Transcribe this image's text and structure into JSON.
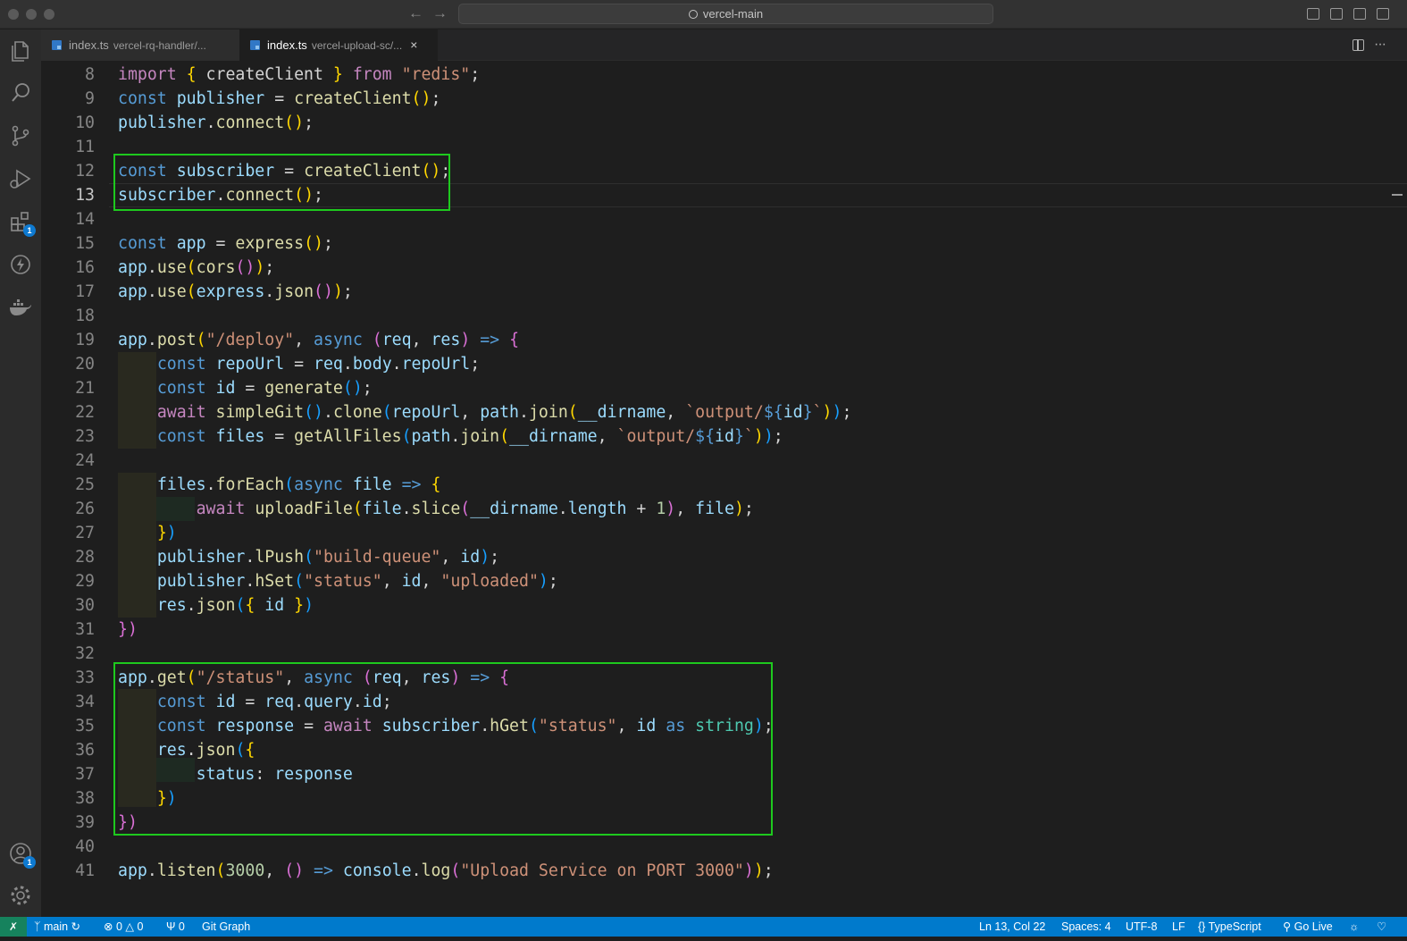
{
  "window": {
    "search_label": "vercel-main"
  },
  "tabs": [
    {
      "name": "index.ts",
      "path": "vercel-rq-handler/...",
      "active": false
    },
    {
      "name": "index.ts",
      "path": "vercel-upload-sc/...",
      "active": true,
      "close": "×"
    }
  ],
  "activity": {
    "extensions_badge": "1",
    "accounts_badge": "1"
  },
  "editor": {
    "current_line": 13,
    "lines": [
      {
        "n": "8"
      },
      {
        "n": "9"
      },
      {
        "n": "10"
      },
      {
        "n": "11"
      },
      {
        "n": "12"
      },
      {
        "n": "13"
      },
      {
        "n": "14"
      },
      {
        "n": "15"
      },
      {
        "n": "16"
      },
      {
        "n": "17"
      },
      {
        "n": "18"
      },
      {
        "n": "19"
      },
      {
        "n": "20"
      },
      {
        "n": "21"
      },
      {
        "n": "22"
      },
      {
        "n": "23"
      },
      {
        "n": "24"
      },
      {
        "n": "25"
      },
      {
        "n": "26"
      },
      {
        "n": "27"
      },
      {
        "n": "28"
      },
      {
        "n": "29"
      },
      {
        "n": "30"
      },
      {
        "n": "31"
      },
      {
        "n": "32"
      },
      {
        "n": "33"
      },
      {
        "n": "34"
      },
      {
        "n": "35"
      },
      {
        "n": "36"
      },
      {
        "n": "37"
      },
      {
        "n": "38"
      },
      {
        "n": "39"
      },
      {
        "n": "40"
      },
      {
        "n": "41"
      }
    ],
    "tokens": {
      "l8": [
        "import",
        " ",
        "{",
        " createClient ",
        "}",
        " from ",
        "\"redis\"",
        ";"
      ],
      "l9": [
        "const",
        " ",
        "publisher",
        " = ",
        "createClient",
        "(",
        ")",
        ";"
      ],
      "l10": [
        "publisher",
        ".",
        "connect",
        "(",
        ")",
        ";"
      ],
      "l12": [
        "const",
        " ",
        "subscriber",
        " = ",
        "createClient",
        "(",
        ")",
        ";"
      ],
      "l13": [
        "subscriber",
        ".",
        "connect",
        "(",
        ")",
        ";"
      ],
      "l15": [
        "const",
        " ",
        "app",
        " = ",
        "express",
        "(",
        ")",
        ";"
      ],
      "l16": [
        "app",
        ".",
        "use",
        "(",
        "cors",
        "(",
        ")",
        ")",
        ";"
      ],
      "l17": [
        "app",
        ".",
        "use",
        "(",
        "express",
        ".",
        "json",
        "(",
        ")",
        ")",
        ";"
      ],
      "l19": [
        "app",
        ".",
        "post",
        "(",
        "\"/deploy\"",
        ", ",
        "async",
        " ",
        "(",
        "req",
        ", ",
        "res",
        ")",
        " => ",
        "{"
      ],
      "l20": [
        "const",
        " ",
        "repoUrl",
        " = ",
        "req",
        ".",
        "body",
        ".",
        "repoUrl",
        ";"
      ],
      "l21": [
        "const",
        " ",
        "id",
        " = ",
        "generate",
        "(",
        ")",
        ";"
      ],
      "l22": [
        "await",
        " ",
        "simpleGit",
        "(",
        ")",
        ".",
        "clone",
        "(",
        "repoUrl",
        ", ",
        "path",
        ".",
        "join",
        "(",
        "__dirname",
        ", ",
        "`output/",
        "${",
        "id",
        "}",
        "`",
        ")",
        ")",
        ";"
      ],
      "l23": [
        "const",
        " ",
        "files",
        " = ",
        "getAllFiles",
        "(",
        "path",
        ".",
        "join",
        "(",
        "__dirname",
        ", ",
        "`output/",
        "${",
        "id",
        "}",
        "`",
        ")",
        ")",
        ";"
      ],
      "l25": [
        "files",
        ".",
        "forEach",
        "(",
        "async",
        " ",
        "file",
        " => ",
        "{"
      ],
      "l26": [
        "await",
        " ",
        "uploadFile",
        "(",
        "file",
        ".",
        "slice",
        "(",
        "__dirname",
        ".",
        "length",
        " + ",
        "1",
        ")",
        ", ",
        "file",
        ")",
        ";"
      ],
      "l27": [
        "}",
        ")"
      ],
      "l28": [
        "publisher",
        ".",
        "lPush",
        "(",
        "\"build-queue\"",
        ", ",
        "id",
        ")",
        ";"
      ],
      "l29": [
        "publisher",
        ".",
        "hSet",
        "(",
        "\"status\"",
        ", ",
        "id",
        ", ",
        "\"uploaded\"",
        ")",
        ";"
      ],
      "l30": [
        "res",
        ".",
        "json",
        "(",
        "{",
        " id ",
        "}",
        ")"
      ],
      "l31": [
        "}",
        ")"
      ],
      "l33": [
        "app",
        ".",
        "get",
        "(",
        "\"/status\"",
        ", ",
        "async",
        " ",
        "(",
        "req",
        ", ",
        "res",
        ")",
        " => ",
        "{"
      ],
      "l34": [
        "const",
        " ",
        "id",
        " = ",
        "req",
        ".",
        "query",
        ".",
        "id",
        ";"
      ],
      "l35": [
        "const",
        " ",
        "response",
        " = ",
        "await",
        " ",
        "subscriber",
        ".",
        "hGet",
        "(",
        "\"status\"",
        ", ",
        "id",
        " as ",
        "string",
        ")",
        ";"
      ],
      "l36": [
        "res",
        ".",
        "json",
        "(",
        "{"
      ],
      "l37": [
        "status",
        ": ",
        "response"
      ],
      "l38": [
        "}",
        ")"
      ],
      "l39": [
        "}",
        ")"
      ],
      "l41": [
        "app",
        ".",
        "listen",
        "(",
        "3000",
        ", ",
        "(",
        ")",
        " => ",
        "console",
        ".",
        "log",
        "(",
        "\"Upload Service on PORT 3000\"",
        ")",
        ")",
        ";"
      ]
    }
  },
  "statusbar": {
    "remote_icon": "remote-icon",
    "branch": "main",
    "errors": "0",
    "warnings": "0",
    "ports": "0",
    "git_graph": "Git Graph",
    "position": "Ln 13, Col 22",
    "spaces": "Spaces: 4",
    "encoding": "UTF-8",
    "eol": "LF",
    "language": "TypeScript",
    "golive": "Go Live"
  },
  "colors": {
    "highlight_box": "#1ec91e",
    "statusbar": "#007acc",
    "ts_icon": "#3178c6"
  }
}
